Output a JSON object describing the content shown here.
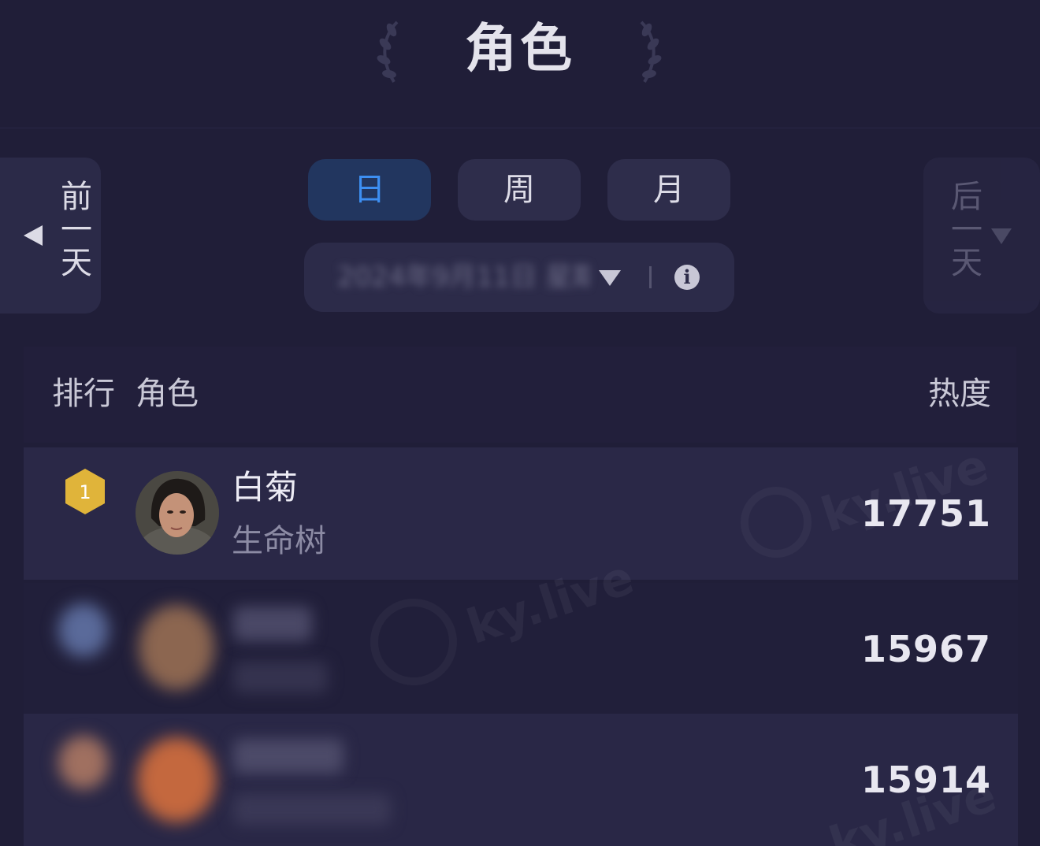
{
  "header": {
    "title": "角色"
  },
  "nav": {
    "prev_label": "前一天",
    "next_label": "后一天"
  },
  "period_tabs": [
    {
      "label": "日",
      "active": true
    },
    {
      "label": "周",
      "active": false
    },
    {
      "label": "月",
      "active": false
    }
  ],
  "selector": {
    "value": "2024年9月11日 星期三"
  },
  "table": {
    "headers": {
      "rank": "排行",
      "role": "角色",
      "heat": "热度"
    },
    "rows": [
      {
        "rank": "1",
        "name": "白菊",
        "drama": "生命树",
        "heat": "17751"
      },
      {
        "rank": "2",
        "name": "",
        "drama": "",
        "heat": "15967"
      },
      {
        "rank": "3",
        "name": "",
        "drama": "",
        "heat": "15914"
      }
    ]
  },
  "watermark": "ky.live",
  "colors": {
    "background": "#201e38",
    "active_tab_bg": "#22365f",
    "active_tab_text": "#3d8ff2",
    "gold_badge": "#e0b43a"
  }
}
